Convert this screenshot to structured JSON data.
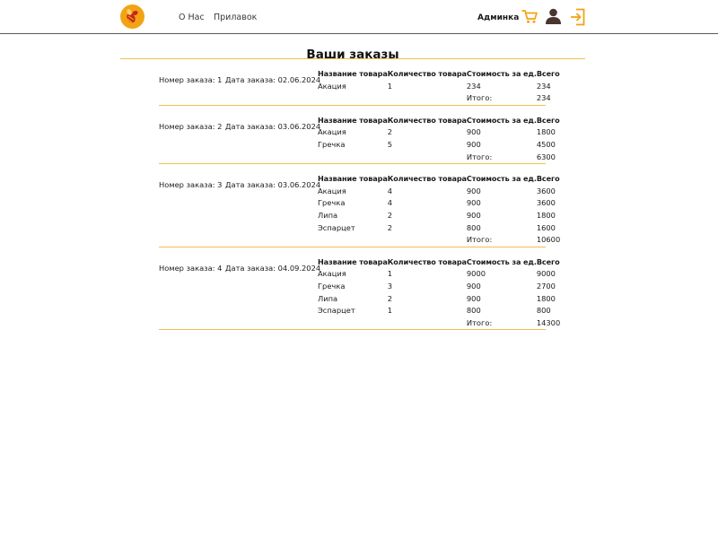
{
  "header": {
    "nav": [
      {
        "label": "О Нас"
      },
      {
        "label": "Прилавок"
      }
    ],
    "user_name": "Админка",
    "icons": [
      "cart-icon",
      "user-icon",
      "logout-icon"
    ],
    "accent_color": "#f2a314"
  },
  "page_title": "Ваши заказы",
  "table_headers": {
    "name": "Название товара",
    "qty": "Количество товара",
    "unit_price": "Стоимость за ед.",
    "total": "Всего"
  },
  "orders": [
    {
      "number_label": "Номер заказа: 1",
      "date_label": "Дата заказа: 02.06.2024",
      "items": [
        {
          "name": "Акация",
          "qty": "1",
          "price": "234",
          "total": "234"
        }
      ],
      "sum_label": "Итого:",
      "sum": "234"
    },
    {
      "number_label": "Номер заказа: 2",
      "date_label": "Дата заказа: 03.06.2024",
      "items": [
        {
          "name": "Акация",
          "qty": "2",
          "price": "900",
          "total": "1800"
        },
        {
          "name": "Гречка",
          "qty": "5",
          "price": "900",
          "total": "4500"
        }
      ],
      "sum_label": "Итого:",
      "sum": "6300"
    },
    {
      "number_label": "Номер заказа: 3",
      "date_label": "Дата заказа: 03.06.2024",
      "items": [
        {
          "name": "Акация",
          "qty": "4",
          "price": "900",
          "total": "3600"
        },
        {
          "name": "Гречка",
          "qty": "4",
          "price": "900",
          "total": "3600"
        },
        {
          "name": "Липа",
          "qty": "2",
          "price": "900",
          "total": "1800"
        },
        {
          "name": "Эспарцет",
          "qty": "2",
          "price": "800",
          "total": "1600"
        }
      ],
      "sum_label": "Итого:",
      "sum": "10600"
    },
    {
      "number_label": "Номер заказа: 4",
      "date_label": "Дата заказа: 04.09.2024",
      "items": [
        {
          "name": "Акация",
          "qty": "1",
          "price": "9000",
          "total": "9000"
        },
        {
          "name": "Гречка",
          "qty": "3",
          "price": "900",
          "total": "2700"
        },
        {
          "name": "Липа",
          "qty": "2",
          "price": "900",
          "total": "1800"
        },
        {
          "name": "Эспарцет",
          "qty": "1",
          "price": "800",
          "total": "800"
        }
      ],
      "sum_label": "Итого:",
      "sum": "14300"
    }
  ]
}
